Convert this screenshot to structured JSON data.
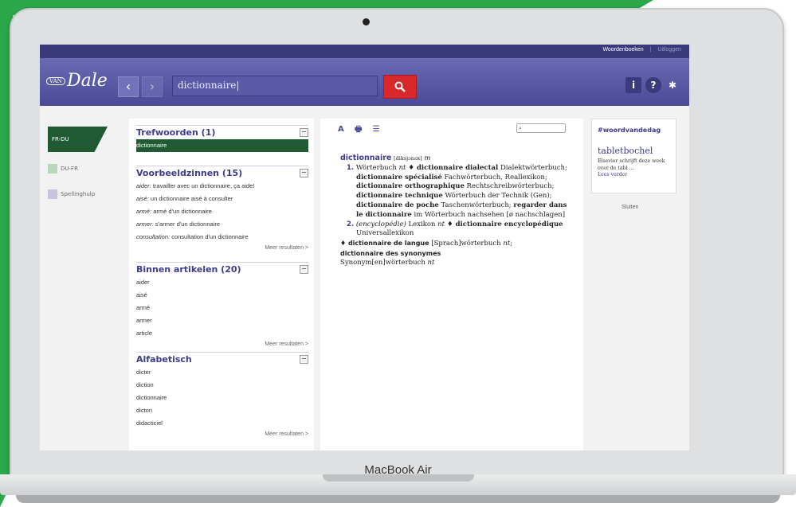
{
  "device": {
    "brand": "MacBook Air"
  },
  "topbar": {
    "dictionaries_link": "Woordenboeken",
    "separator": "|",
    "logout_link": "Uitloggen"
  },
  "header": {
    "logo_small": "VAN",
    "logo_name": "Dale",
    "back_symbol": "‹",
    "forward_symbol": "›",
    "search_value": "dictionnaire|",
    "search_icon": "magnifier",
    "info_icon_glyph": "i",
    "help_icon_glyph": "?",
    "settings_icon_glyph": "✱"
  },
  "languages": [
    {
      "label": "FR-DU",
      "active": true
    },
    {
      "label": "DU-FR",
      "active": false
    },
    {
      "label": "Spellinghulp",
      "active": false
    }
  ],
  "results": {
    "headwords": {
      "title": "Trefwoorden (1)",
      "items": [
        "dictionnaire"
      ]
    },
    "examples": {
      "title": "Voorbeeldzinnen (15)",
      "items": [
        {
          "key": "aider:",
          "text": " travailler avec un dictionnaire, ça aide!"
        },
        {
          "key": "aisé:",
          "text": " un dictionnaire aisé à consulter"
        },
        {
          "key": "armé:",
          "text": " armé d'un dictionnaire"
        },
        {
          "key": "armer:",
          "text": " s'armer d'un dictionnaire"
        },
        {
          "key": "consultation:",
          "text": " consultation d'un dictionnaire"
        }
      ],
      "more": "Meer resultaten >"
    },
    "in_articles": {
      "title": "Binnen artikelen (20)",
      "items": [
        "aider",
        "aisé",
        "armé",
        "armer",
        "article"
      ],
      "more": "Meer resultaten >"
    },
    "alphabetical": {
      "title": "Alfabetisch",
      "items": [
        "dicter",
        "diction",
        "dictionnaire",
        "dicton",
        "didacticiel"
      ],
      "more": "Meer resultaten >"
    },
    "collapse_symbol": "−"
  },
  "article": {
    "toolbar": {
      "font_icon": "A",
      "print_icon": "🖶",
      "list_icon": "☰"
    },
    "find_icon": "⌕",
    "headword": "dictionnaire",
    "pron": "[diksjɔnɛʀ]",
    "gender": "m",
    "sense1_num": "1.",
    "sense1_a": "Wörterbuch ",
    "sense1_a_g": "nt",
    "sense1_b": " ♦ dictionnaire dialectal",
    "sense1_c": "Dialektwörterbuch; ",
    "sense1_d": "dictionnaire spécialisé",
    "sense1_e": "Fachwörterbuch, Reallexikon; ",
    "sense1_f": "dictionnaire orthographique",
    "sense1_g": " Rechtschreibwörterbuch; ",
    "sense1_h": "dictionnaire technique",
    "sense1_i": " Wörterbuch der Technik (Gen); ",
    "sense1_j": "dictionnaire de poche",
    "sense1_k": " Taschenwörterbuch; ",
    "sense1_l": "regarder dans le dictionnaire",
    "sense1_m": " im Wörterbuch nachsehen [ø nachschlagen]",
    "sense2_num": "2.",
    "sense2_a": "(encyclopédie)",
    "sense2_b": " Lexikon ",
    "sense2_b_g": "nt",
    "sense2_c": " ♦ dictionnaire encyclopédique",
    "sense2_d": " Universallexikon",
    "deriv1_a": "♦ dictionnaire de langue",
    "deriv1_b": " [Sprach]wörterbuch ",
    "deriv1_b_g": "nt",
    "deriv1_c": ";",
    "deriv2_a": "dictionnaire des synonymes",
    "deriv2_b": "Synonym[en]wörterbuch ",
    "deriv2_b_g": "nt"
  },
  "word_of_day": {
    "heading": "#woordvandedag",
    "word": "tabletbochel",
    "text": "Elsevier schrijft deze week over de tabl ...",
    "link": "Lees verder"
  },
  "close_label": "Sluiten"
}
